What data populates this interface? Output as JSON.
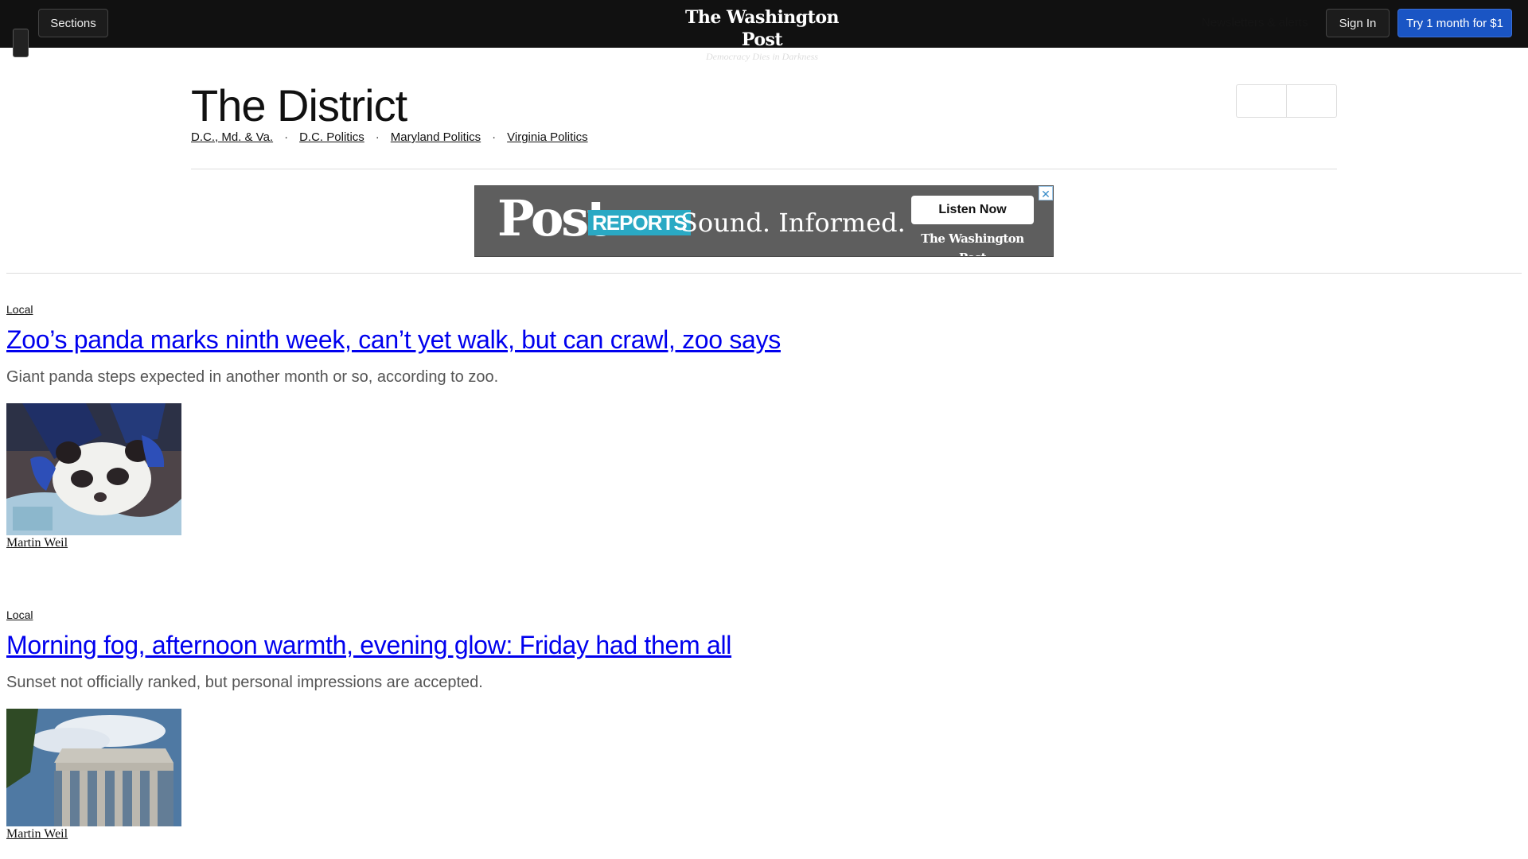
{
  "topbar": {
    "sections_label": "Sections",
    "brand_name": "The Washington Post",
    "brand_tagline": "Democracy Dies in Darkness",
    "newsletters_label": "Newsletters & alerts",
    "signin_label": "Sign In",
    "try_label": "Try 1 month for $1"
  },
  "header": {
    "title": "The District",
    "subnav": [
      {
        "label": "D.C., Md. & Va."
      },
      {
        "label": "D.C. Politics"
      },
      {
        "label": "Maryland Politics"
      },
      {
        "label": "Virginia Politics"
      }
    ]
  },
  "ad": {
    "post_word": "Post",
    "reports_word": "REPORTS",
    "slogan": "Sound. Informed.",
    "cta": "Listen Now",
    "brand": "The Washington Post",
    "close_glyph": "✕"
  },
  "articles": [
    {
      "kicker": "Local",
      "headline": "Zoo’s panda marks ninth week, can’t yet walk, but can crawl, zoo says",
      "blurb": "Giant panda steps expected in another month or so, according to zoo.",
      "byline": "Martin Weil"
    },
    {
      "kicker": "Local",
      "headline": "Morning fog, afternoon warmth, evening glow: Friday had them all",
      "blurb": "Sunset not officially ranked, but personal impressions are accepted.",
      "byline": "Martin Weil"
    }
  ],
  "colors": {
    "topbar_bg": "#111111",
    "cta_blue": "#1a55c4",
    "link_blue": "#0000ee"
  }
}
